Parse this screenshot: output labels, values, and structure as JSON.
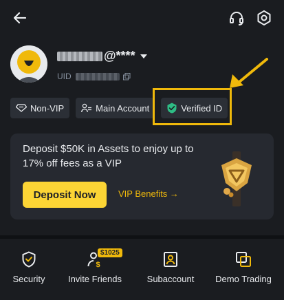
{
  "header": {
    "back_icon": "back-arrow-icon",
    "support_icon": "headset-icon",
    "settings_icon": "gear-icon"
  },
  "profile": {
    "username_suffix": "@****",
    "uid_label": "UID",
    "avatar_icon": "avatar-smiley"
  },
  "badges": [
    {
      "label": "Non-VIP",
      "icon": "diamond-icon"
    },
    {
      "label": "Main Account",
      "icon": "users-icon"
    },
    {
      "label": "Verified ID",
      "icon": "verified-shield-icon"
    }
  ],
  "promo_card": {
    "text": "Deposit $50K in Assets to enjoy up to 17% off fees as a VIP",
    "button_label": "Deposit Now",
    "link_label": "VIP Benefits →"
  },
  "bottom_nav": [
    {
      "label": "Security",
      "icon": "shield-icon"
    },
    {
      "label": "Invite Friends",
      "icon": "invite-icon",
      "badge": "$1025"
    },
    {
      "label": "Subaccount",
      "icon": "subaccount-icon"
    },
    {
      "label": "Demo Trading",
      "icon": "demo-trading-icon"
    }
  ],
  "colors": {
    "accent": "#f0b90b",
    "button": "#fcd535",
    "background": "#1a1c20",
    "card": "#262930",
    "verified": "#2ebd85"
  }
}
